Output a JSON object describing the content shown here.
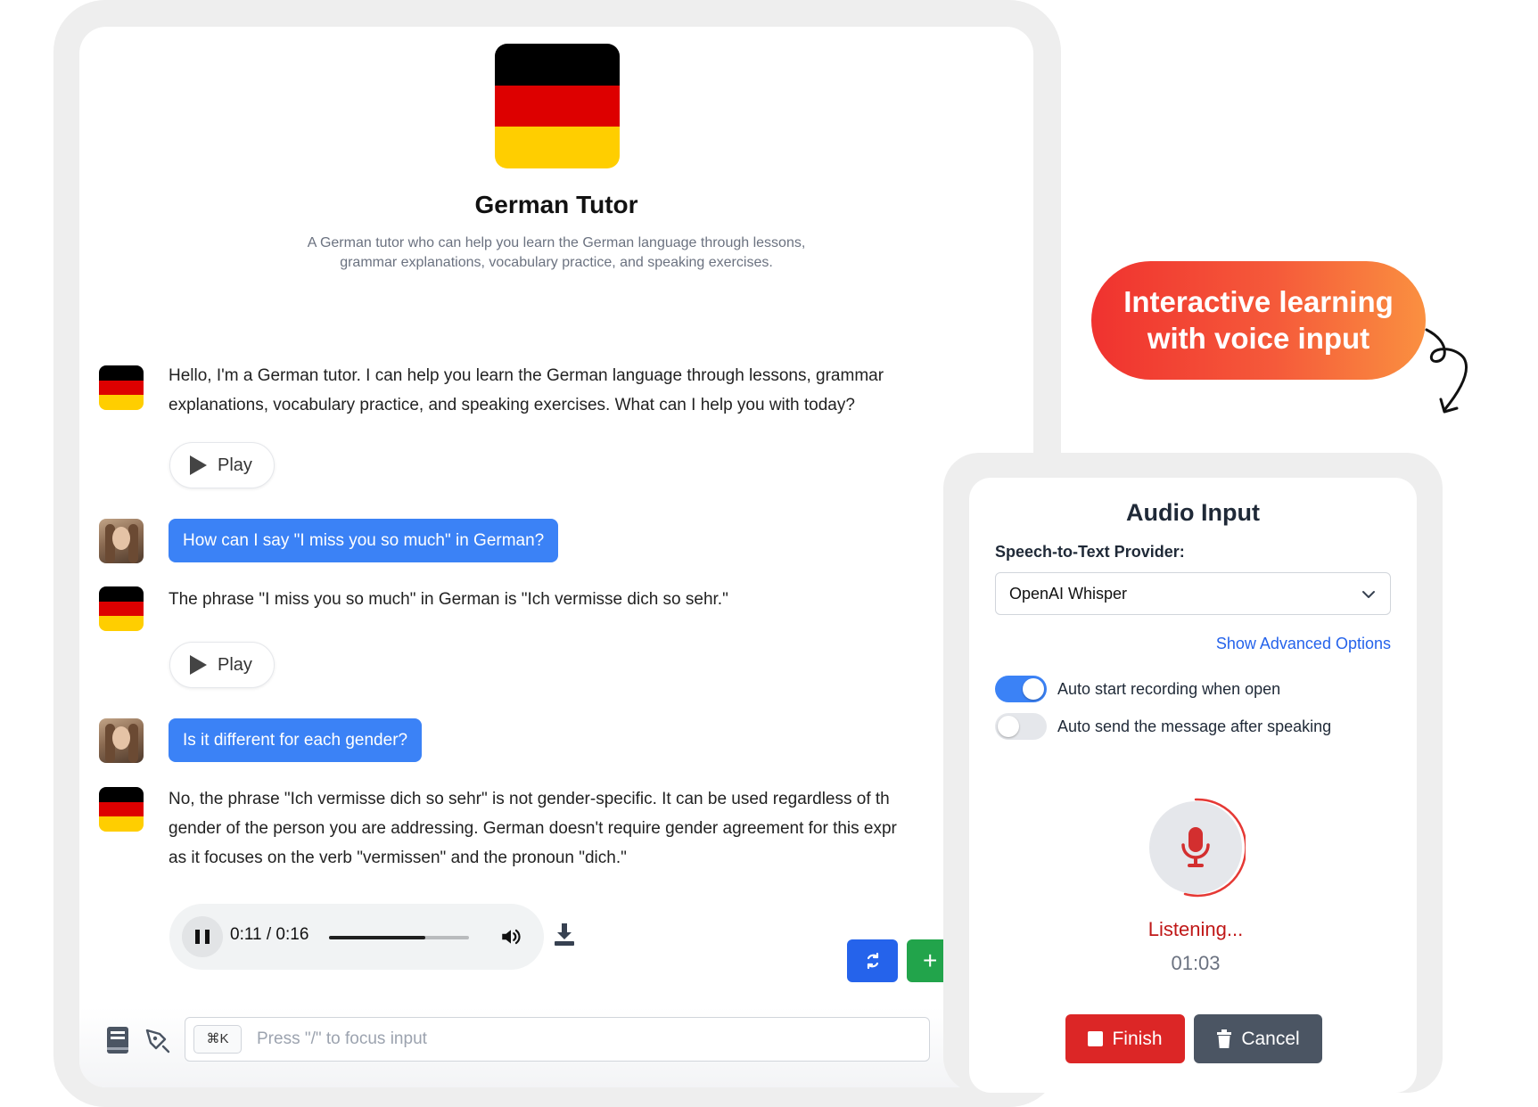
{
  "tutor": {
    "name": "German Tutor",
    "description": "A German tutor who can help you learn the German language through lessons, grammar explanations, vocabulary practice, and speaking exercises.",
    "flag_colors": [
      "#000000",
      "#dd0000",
      "#ffce00"
    ]
  },
  "messages": [
    {
      "role": "assistant",
      "lines": [
        "Hello, I'm a German tutor. I can help you learn the German language through lessons, grammar",
        "explanations, vocabulary practice, and speaking exercises. What can I help you with today?"
      ]
    },
    {
      "role": "user",
      "text": "How can I say \"I miss you so much\" in German?"
    },
    {
      "role": "assistant",
      "lines": [
        "The phrase \"I miss you so much\" in German is \"Ich vermisse dich so sehr.\""
      ]
    },
    {
      "role": "user",
      "text": "Is it different for each gender?"
    },
    {
      "role": "assistant",
      "lines": [
        "No, the phrase \"Ich vermisse dich so sehr\" is not gender-specific. It can be used regardless of th",
        "gender of the person you are addressing. German doesn't require gender agreement for this expr",
        "as it focuses on the verb \"vermissen\" and the pronoun \"dich.\""
      ]
    }
  ],
  "play_label": "Play",
  "audio_player": {
    "time": "0:11 / 0:16",
    "progress": 0.6875
  },
  "composer": {
    "shortcut": "⌘K",
    "placeholder": "Press \"/\" to focus input"
  },
  "callout": {
    "line1": "Interactive learning",
    "line2": "with voice input"
  },
  "audio_input": {
    "title": "Audio Input",
    "provider_label": "Speech-to-Text Provider:",
    "provider_value": "OpenAI Whisper",
    "advanced_link": "Show Advanced Options",
    "options": [
      {
        "label": "Auto start recording when open",
        "on": true
      },
      {
        "label": "Auto send the message after speaking",
        "on": false
      }
    ],
    "status": "Listening...",
    "timer": "01:03",
    "finish_label": "Finish",
    "cancel_label": "Cancel"
  },
  "colors": {
    "accent": "#3b82f6",
    "danger": "#dc2626",
    "success": "#22a44b",
    "secondary": "#4b5563"
  }
}
